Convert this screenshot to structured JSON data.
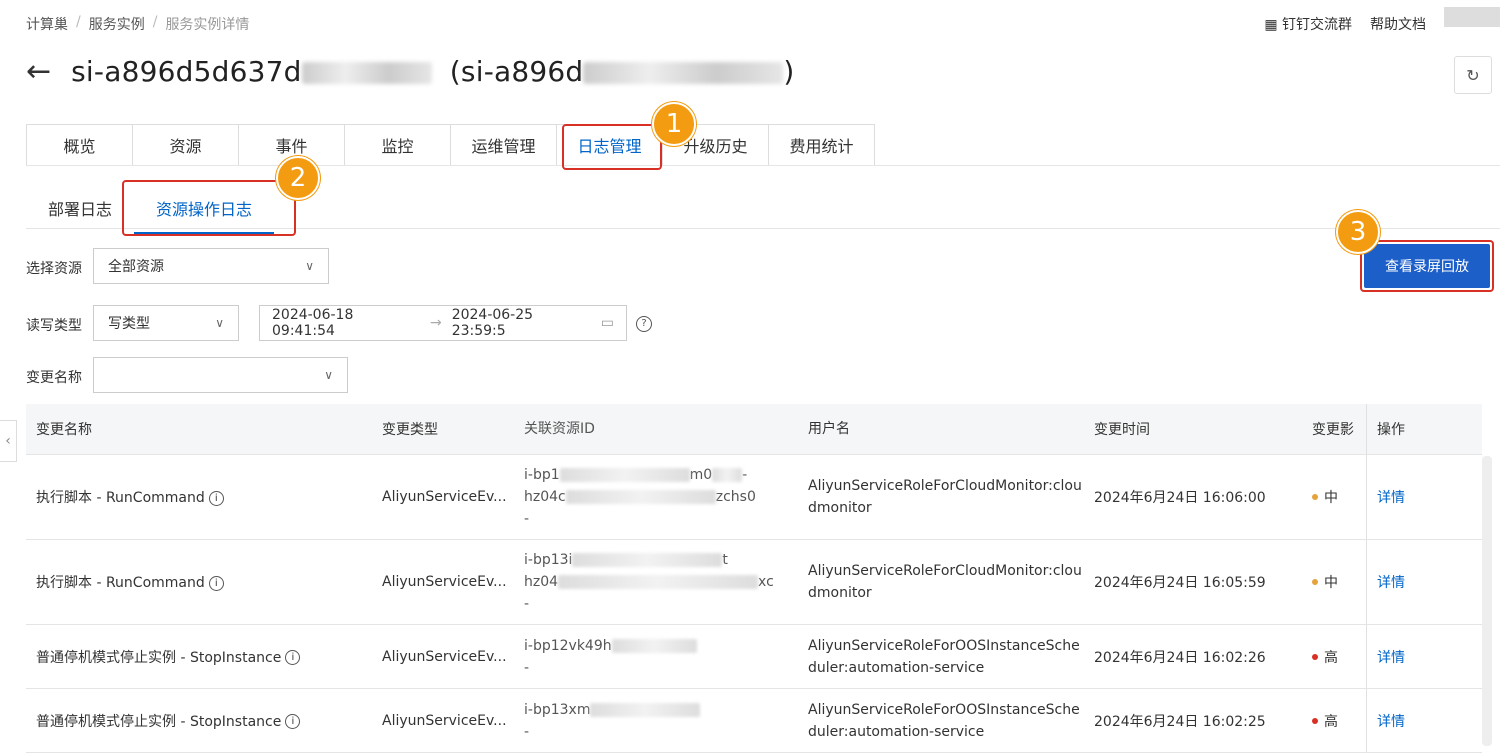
{
  "breadcrumb": [
    "计算巢",
    "服务实例",
    "服务实例详情"
  ],
  "top_links": {
    "dingtalk": "钉钉交流群",
    "help_doc": "帮助文档"
  },
  "title": {
    "id_prefix": "si-a896d5d637d",
    "paren_prefix": "(si-a896d",
    "paren_suffix": ")"
  },
  "tabs": [
    "概览",
    "资源",
    "事件",
    "监控",
    "运维管理",
    "日志管理",
    "升级历史",
    "费用统计"
  ],
  "subtabs": [
    "部署日志",
    "资源操作日志"
  ],
  "badges": [
    "1",
    "2",
    "3"
  ],
  "filters": {
    "resource_label": "选择资源",
    "resource_value": "全部资源",
    "rw_label": "读写类型",
    "rw_value": "写类型",
    "date_start": "2024-06-18 09:41:54",
    "date_end": "2024-06-25 23:59:5",
    "date_arrow": "→",
    "change_name_label": "变更名称",
    "change_name_value": ""
  },
  "replay_button": "查看录屏回放",
  "table": {
    "headers": [
      "变更名称",
      "变更类型",
      "关联资源ID",
      "用户名",
      "变更时间",
      "变更影",
      "操作"
    ],
    "rows": [
      {
        "name": "执行脚本 - RunCommand",
        "type": "AliyunServiceEv...",
        "rid_1": "i-bp1",
        "rid_1b": "m0",
        "rid_2": "hz04c",
        "rid_2b": "zchs0",
        "rid_3": "-",
        "user_1": "AliyunServiceRoleForCloudMonitor:clou",
        "user_2": "dmonitor",
        "time": "2024年6月24日 16:06:00",
        "impact": "中",
        "impact_color": "#e6a23c",
        "action": "详情"
      },
      {
        "name": "执行脚本 - RunCommand",
        "type": "AliyunServiceEv...",
        "rid_1": "i-bp13i",
        "rid_1b": "t",
        "rid_2": "hz04",
        "rid_2b": "xc",
        "rid_3": "-",
        "user_1": "AliyunServiceRoleForCloudMonitor:clou",
        "user_2": "dmonitor",
        "time": "2024年6月24日 16:05:59",
        "impact": "中",
        "impact_color": "#e6a23c",
        "action": "详情"
      },
      {
        "name": "普通停机模式停止实例 - StopInstance",
        "type": "AliyunServiceEv...",
        "rid_1": "i-bp12vk49h",
        "rid_1b": "",
        "rid_2": "-",
        "rid_2b": "",
        "rid_3": "",
        "user_1": "AliyunServiceRoleForOOSInstanceSche",
        "user_2": "duler:automation-service",
        "time": "2024年6月24日 16:02:26",
        "impact": "高",
        "impact_color": "#d93026",
        "action": "详情"
      },
      {
        "name": "普通停机模式停止实例 - StopInstance",
        "type": "AliyunServiceEv...",
        "rid_1": "i-bp13xm",
        "rid_1b": "",
        "rid_2": "-",
        "rid_2b": "",
        "rid_3": "",
        "user_1": "AliyunServiceRoleForOOSInstanceSche",
        "user_2": "duler:automation-service",
        "time": "2024年6月24日 16:02:25",
        "impact": "高",
        "impact_color": "#d93026",
        "action": "详情"
      }
    ]
  },
  "icons": {
    "back": "←",
    "refresh": "↻",
    "chevron": "∨",
    "calendar": "▭",
    "help": "?",
    "info": "i",
    "collapse": "‹"
  }
}
